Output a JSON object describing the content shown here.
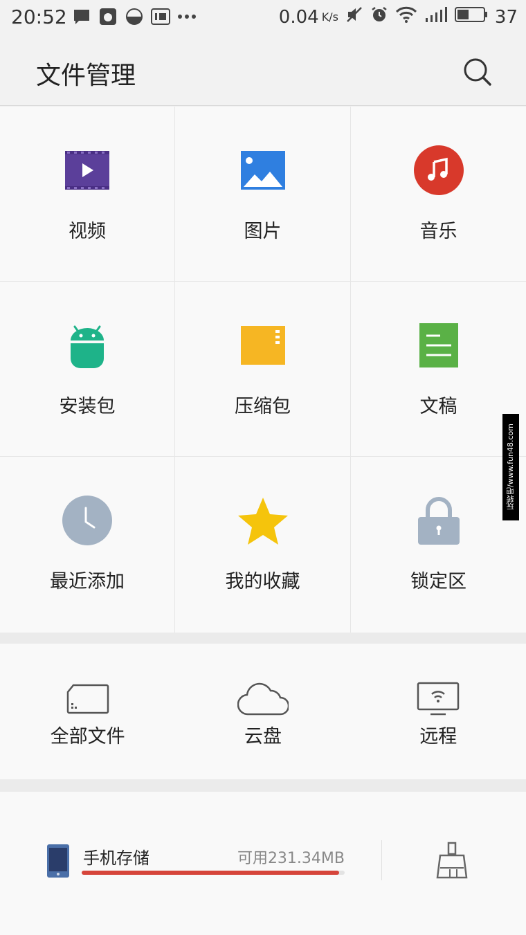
{
  "status": {
    "time": "20:52",
    "speed": "0.04",
    "speed_unit": "K/s",
    "battery": "37"
  },
  "appbar": {
    "title": "文件管理"
  },
  "categories": [
    {
      "label": "视频",
      "icon": "video-icon"
    },
    {
      "label": "图片",
      "icon": "image-icon"
    },
    {
      "label": "音乐",
      "icon": "music-icon"
    },
    {
      "label": "安装包",
      "icon": "android-icon"
    },
    {
      "label": "压缩包",
      "icon": "archive-icon"
    },
    {
      "label": "文稿",
      "icon": "document-icon"
    },
    {
      "label": "最近添加",
      "icon": "clock-icon"
    },
    {
      "label": "我的收藏",
      "icon": "star-icon"
    },
    {
      "label": "锁定区",
      "icon": "lock-icon"
    }
  ],
  "storage": [
    {
      "label": "全部文件",
      "icon": "sd-card-icon"
    },
    {
      "label": "云盘",
      "icon": "cloud-icon"
    },
    {
      "label": "远程",
      "icon": "remote-tv-icon"
    }
  ],
  "device": {
    "name": "手机存储",
    "available": "可用231.34MB",
    "used_fraction": 0.98
  },
  "watermark": "玩转吧/www.fun48.com",
  "colors": {
    "video": "#5b3f9a",
    "image": "#2f7fe0",
    "music": "#d8392b",
    "android": "#1eb389",
    "archive": "#f6b623",
    "document": "#5ab146",
    "clock": "#a3b2c3",
    "star": "#f5c40c",
    "lock": "#a3b2c3",
    "progress": "#d6453b"
  }
}
